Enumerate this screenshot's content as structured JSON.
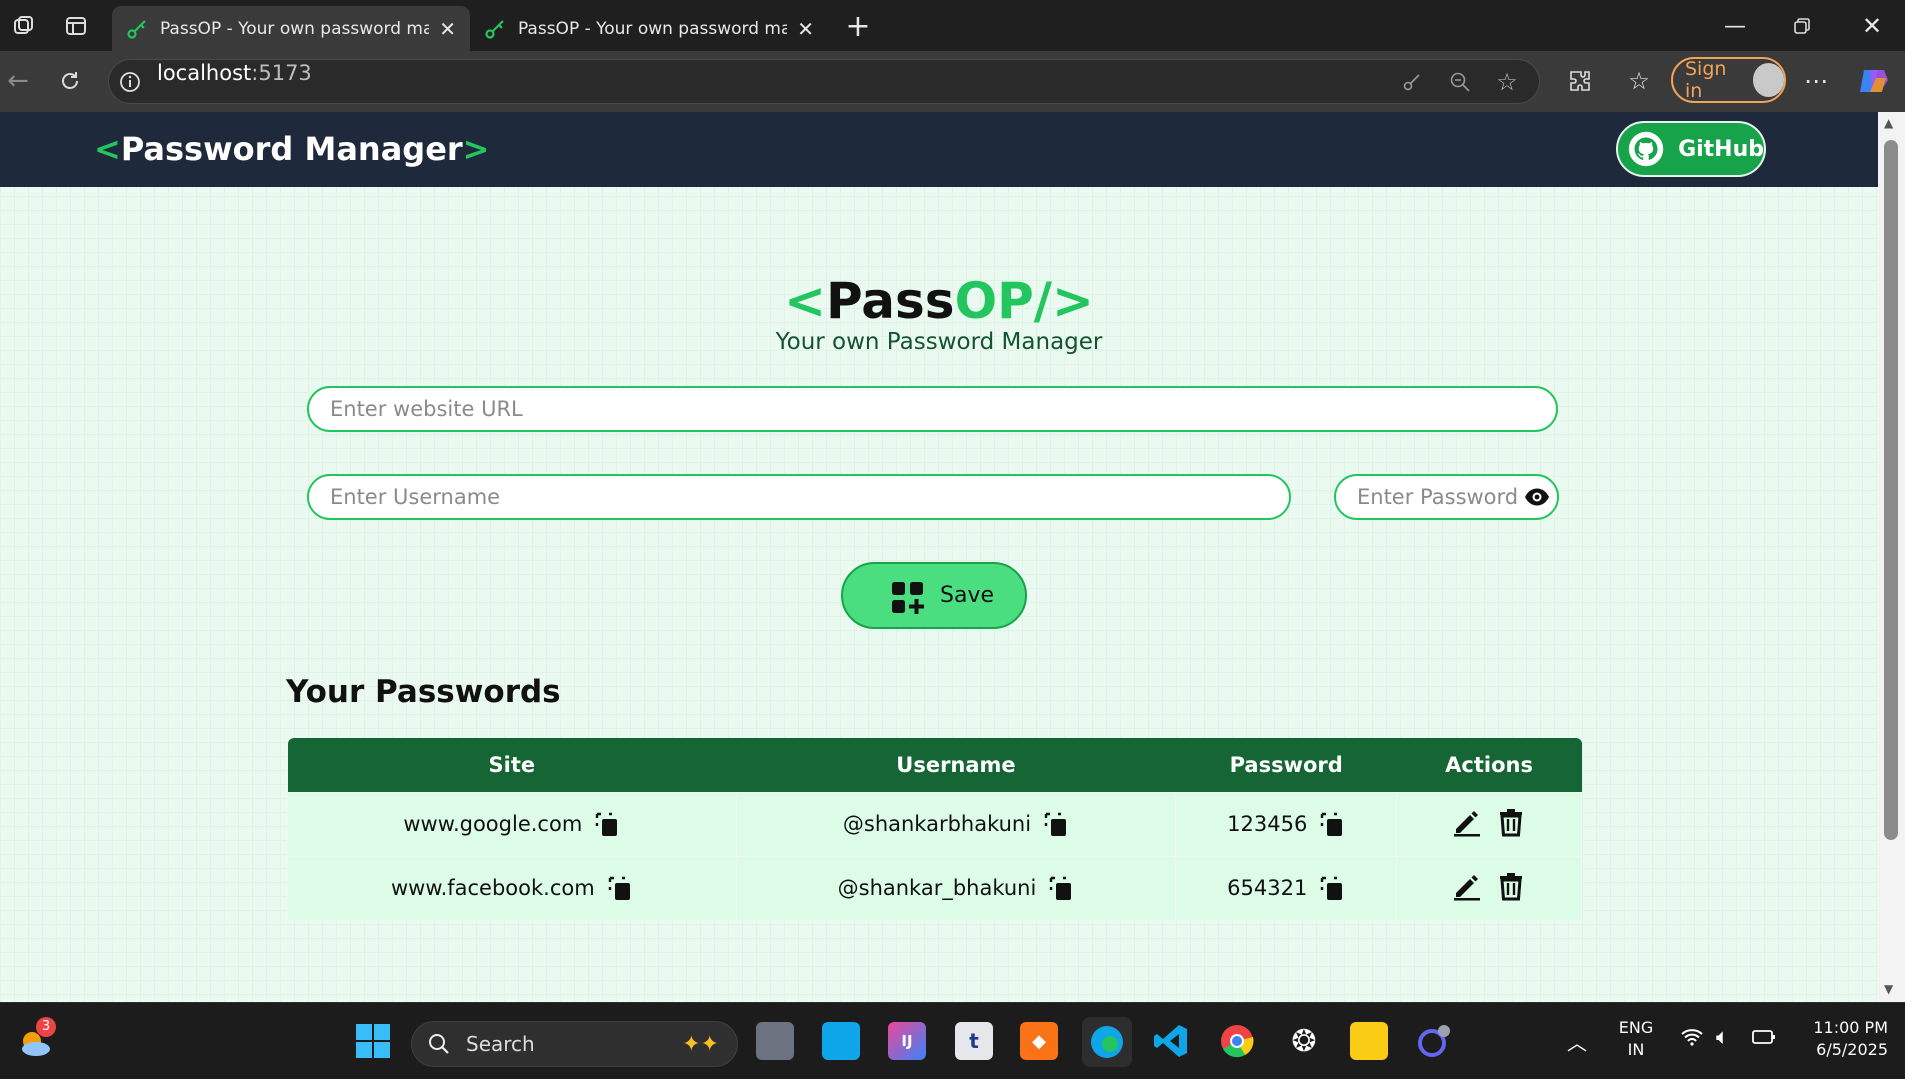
{
  "browser": {
    "tabs": [
      {
        "title": "PassOP - Your own password manager",
        "active": true
      },
      {
        "title": "PassOP - Your own password manager",
        "active": false
      }
    ],
    "url_host": "localhost",
    "url_port": ":5173",
    "signin_label": "Sign in"
  },
  "nav": {
    "logo_open": "<",
    "logo_text": "Password Manager",
    "logo_close": ">",
    "github_label": "GitHub"
  },
  "hero": {
    "title_open": "<",
    "title_pass": "Pass",
    "title_op": "OP/",
    "title_close": ">",
    "subtitle": "Your own Password Manager"
  },
  "form": {
    "url_placeholder": "Enter website URL",
    "username_placeholder": "Enter Username",
    "password_placeholder": "Enter Password",
    "save_label": "Save"
  },
  "passwords": {
    "heading": "Your Passwords",
    "columns": [
      "Site",
      "Username",
      "Password",
      "Actions"
    ],
    "rows": [
      {
        "site": "www.google.com",
        "username": "@shankarbhakuni",
        "password": "123456"
      },
      {
        "site": "www.facebook.com",
        "username": "@shankar_bhakuni",
        "password": "654321"
      }
    ]
  },
  "taskbar": {
    "search_label": "Search",
    "weather_badge": "3",
    "lang_line1": "ENG",
    "lang_line2": "IN",
    "time": "11:00 PM",
    "date": "6/5/2025",
    "icons": [
      "start-icon",
      "search-icon",
      "task-view-icon",
      "store-icon",
      "intellij-icon",
      "typora-icon",
      "brave-icon",
      "edge-icon",
      "vscode-icon",
      "chrome-icon",
      "chatgpt-icon",
      "file-explorer-icon",
      "app-icon"
    ]
  },
  "colors": {
    "accent_green": "#22c55e",
    "nav_bg": "#1e293b",
    "table_header": "#166534",
    "row_bg": "#dcfce7"
  }
}
